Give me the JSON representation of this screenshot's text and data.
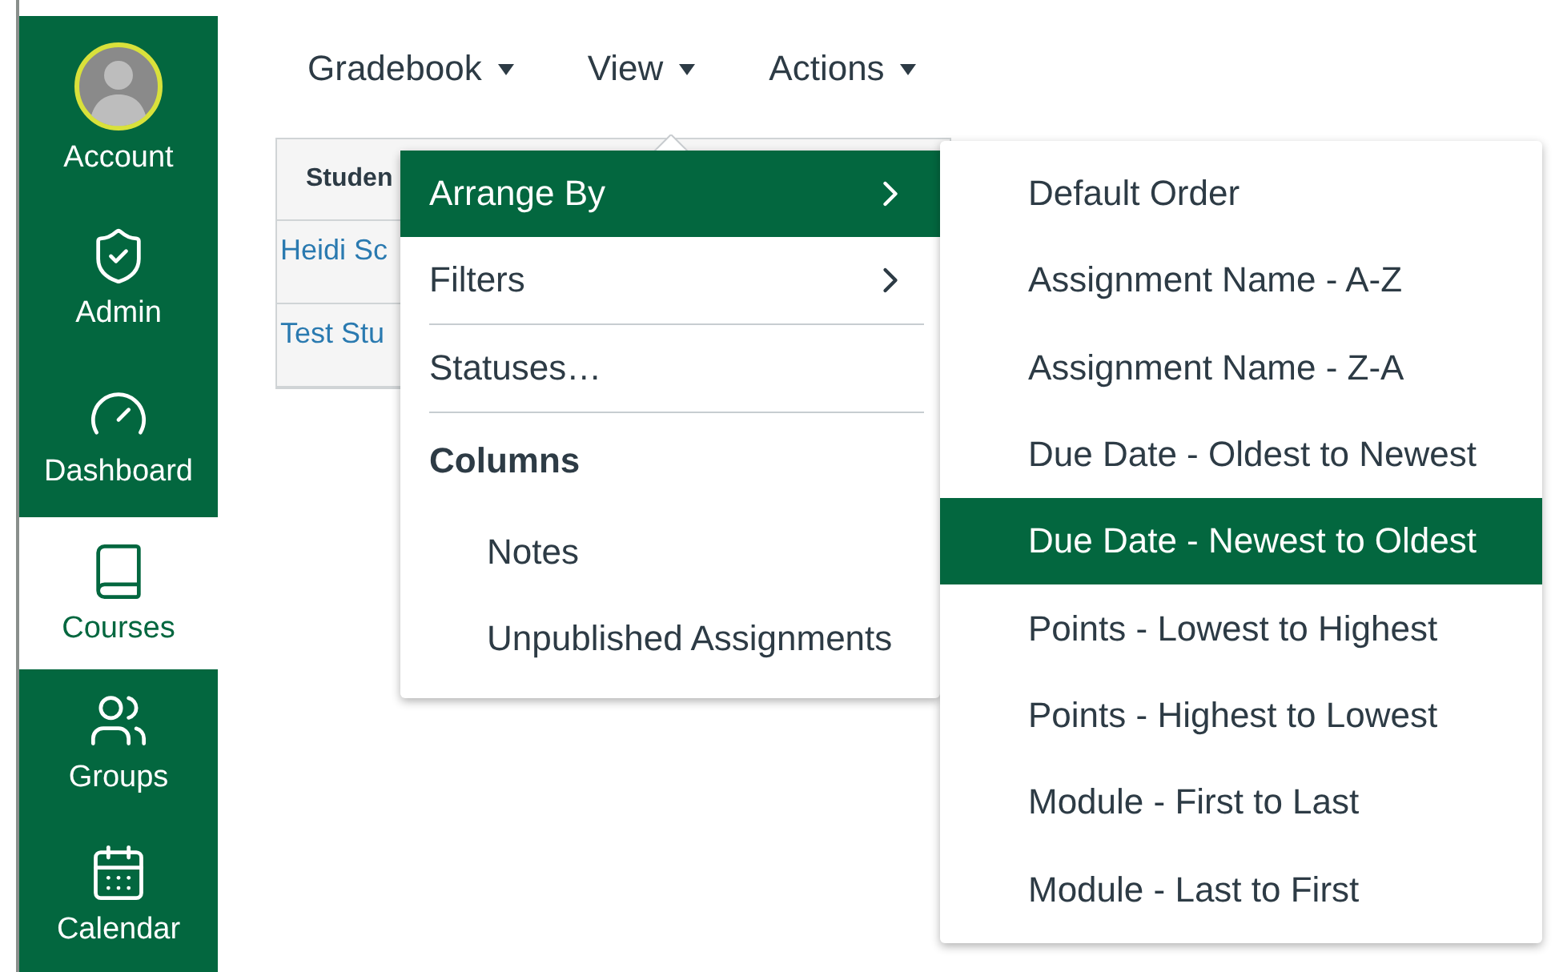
{
  "sidebar": {
    "items": [
      {
        "kind": "account",
        "label": "Account",
        "selected": false
      },
      {
        "kind": "admin",
        "label": "Admin",
        "selected": false
      },
      {
        "kind": "dashboard",
        "label": "Dashboard",
        "selected": false
      },
      {
        "kind": "courses",
        "label": "Courses",
        "selected": true
      },
      {
        "kind": "groups",
        "label": "Groups",
        "selected": false
      },
      {
        "kind": "calendar",
        "label": "Calendar",
        "selected": false
      }
    ]
  },
  "nav": [
    {
      "label": "Gradebook"
    },
    {
      "label": "View"
    },
    {
      "label": "Actions"
    }
  ],
  "table": {
    "columns": [
      "Studen"
    ],
    "rows": [
      [
        "Heidi Sc"
      ],
      [
        "Test Stu"
      ]
    ]
  },
  "view_menu": [
    {
      "kind": "submenu",
      "label": "Arrange By",
      "selected": true
    },
    {
      "kind": "submenu",
      "label": "Filters",
      "selected": false
    },
    {
      "kind": "divider"
    },
    {
      "kind": "item",
      "label": "Statuses…",
      "selected": false
    },
    {
      "kind": "divider"
    },
    {
      "kind": "header",
      "label": "Columns"
    },
    {
      "kind": "option",
      "label": "Notes",
      "selected": false
    },
    {
      "kind": "option",
      "label": "Unpublished Assignments",
      "selected": false
    }
  ],
  "arrange_menu": [
    {
      "label": "Default Order",
      "selected": false
    },
    {
      "label": "Assignment Name - A-Z",
      "selected": false
    },
    {
      "label": "Assignment Name - Z-A",
      "selected": false
    },
    {
      "label": "Due Date - Oldest to Newest",
      "selected": false
    },
    {
      "label": "Due Date - Newest to Oldest",
      "selected": true
    },
    {
      "label": "Points - Lowest to Highest",
      "selected": false
    },
    {
      "label": "Points - Highest to Lowest",
      "selected": false
    },
    {
      "label": "Module - First to Last",
      "selected": false
    },
    {
      "label": "Module - Last to First",
      "selected": false
    }
  ]
}
